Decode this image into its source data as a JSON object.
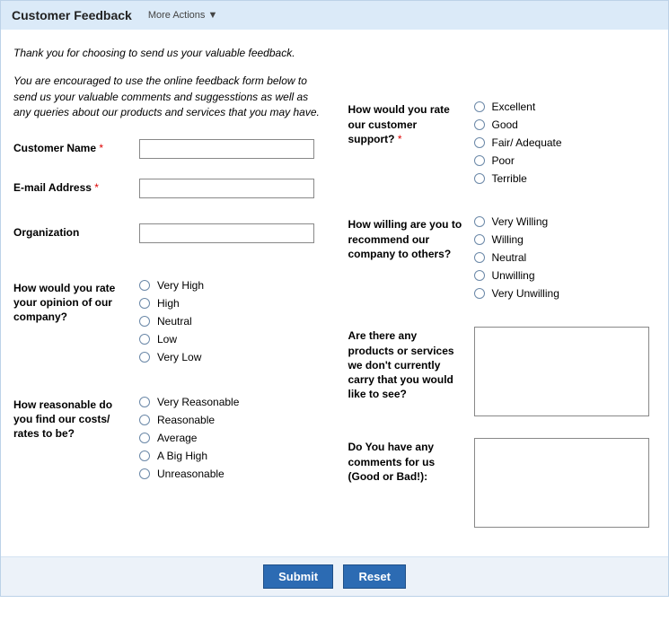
{
  "header": {
    "title": "Customer Feedback",
    "more_actions": "More Actions ▼"
  },
  "intro_line1": "Thank you for choosing to send us your valuable feedback.",
  "intro_line2": "You are encouraged to use the online feedback form below to send us your valuable comments and suggesstions as well as any queries about our products and services that you may have.",
  "left": {
    "name_label": "Customer Name",
    "email_label": "E-mail Address",
    "org_label": "Organization",
    "opinion_label": "How would you rate your opinion of our company?",
    "opinion_opts": {
      "o0": "Very High",
      "o1": "High",
      "o2": "Neutral",
      "o3": "Low",
      "o4": "Very Low"
    },
    "costs_label": "How reasonable do you find our costs/ rates to be?",
    "costs_opts": {
      "o0": "Very Reasonable",
      "o1": "Reasonable",
      "o2": "Average",
      "o3": "A Big High",
      "o4": "Unreasonable"
    }
  },
  "right": {
    "support_label": "How would you rate our customer support?",
    "support_opts": {
      "o0": "Excellent",
      "o1": "Good",
      "o2": "Fair/ Adequate",
      "o3": "Poor",
      "o4": "Terrible"
    },
    "recommend_label": "How willing are you to recommend our company to others?",
    "recommend_opts": {
      "o0": "Very Willing",
      "o1": "Willing",
      "o2": "Neutral",
      "o3": "Unwilling",
      "o4": "Very Unwilling"
    },
    "products_label": "Are there any products or services we don't currently carry that you would like to see?",
    "comments_label": "Do You have any comments for us (Good or Bad!):"
  },
  "footer": {
    "submit": "Submit",
    "reset": "Reset"
  },
  "required_asterisk": "*"
}
